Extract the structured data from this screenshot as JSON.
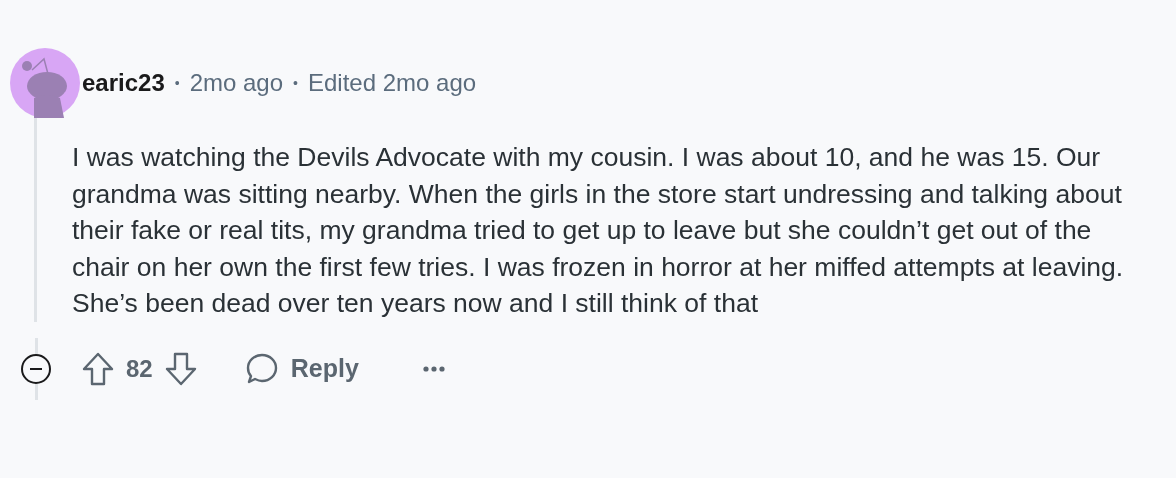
{
  "comment": {
    "username": "earic23",
    "separator_1": "•",
    "time": "2mo ago",
    "separator_2": "•",
    "edited": "Edited 2mo ago",
    "body": "I was watching the Devils Advocate with my cousin. I was about 10, and he was 15. Our grandma was sitting nearby. When the girls in the store start undressing and talking about their fake or real tits, my grandma tried to get up to leave but she couldn’t get out of the chair on her own the first few tries. I was frozen in horror at her miffed attempts at leaving. She’s been dead over ten years now and I still think of that",
    "score": "82",
    "reply_label": "Reply"
  }
}
